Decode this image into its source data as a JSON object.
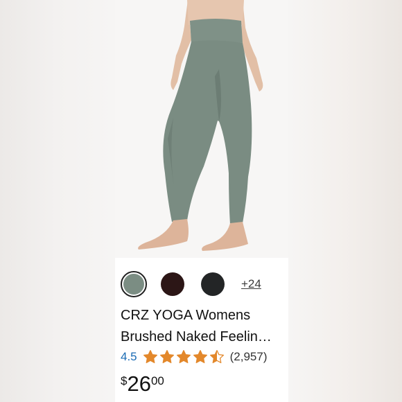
{
  "product": {
    "image_alt": "green leggings on model",
    "title_line1": "CRZ YOGA Womens",
    "title_line2": "Brushed Naked Feelin…",
    "rating_value": "4.5",
    "rating_stars": 4.5,
    "rating_max": 5,
    "review_count": "(2,957)",
    "price_symbol": "$",
    "price_whole": "26",
    "price_fraction": "00"
  },
  "swatches": {
    "colors": [
      {
        "name": "sage-green",
        "hex": "#7b8d83",
        "selected": true
      },
      {
        "name": "dark-brown",
        "hex": "#2c1616",
        "selected": false
      },
      {
        "name": "black",
        "hex": "#232526",
        "selected": false
      }
    ],
    "more_label": "+24"
  },
  "theme": {
    "star_color": "#e3882b",
    "rating_color": "#1a6bb4"
  }
}
